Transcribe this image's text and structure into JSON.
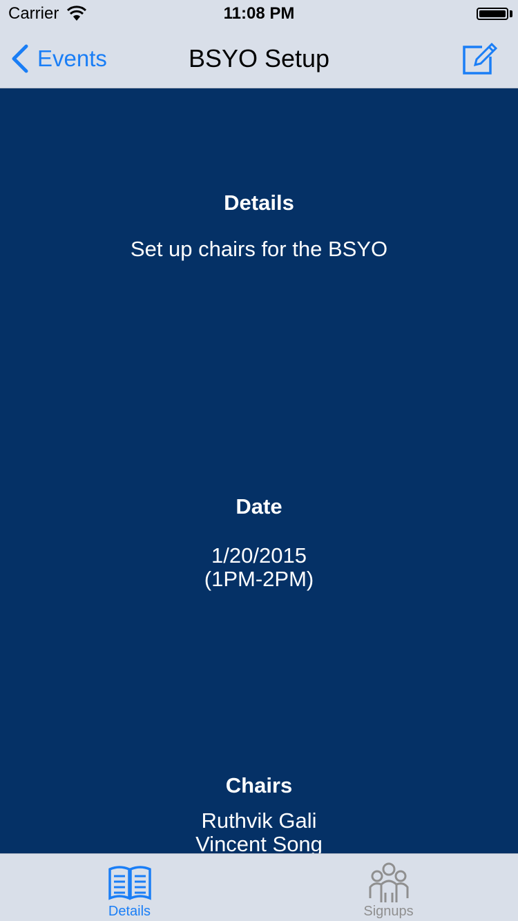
{
  "status_bar": {
    "carrier": "Carrier",
    "time": "11:08 PM"
  },
  "nav": {
    "back_label": "Events",
    "title": "BSYO Setup"
  },
  "details": {
    "heading": "Details",
    "text": "Set up chairs for the BSYO"
  },
  "date": {
    "heading": "Date",
    "date": "1/20/2015",
    "time_range": "(1PM-2PM)"
  },
  "chairs": {
    "heading": "Chairs",
    "names": [
      "Ruthvik Gali",
      "Vincent Song"
    ]
  },
  "tabs": [
    {
      "label": "Details",
      "icon": "book-icon",
      "selected": true
    },
    {
      "label": "Signups",
      "icon": "people-icon",
      "selected": false
    }
  ],
  "colors": {
    "accent": "#1a7ef6",
    "background": "#053166",
    "bar": "#d9dfe9",
    "inactive_tab": "#8f8f8f"
  }
}
